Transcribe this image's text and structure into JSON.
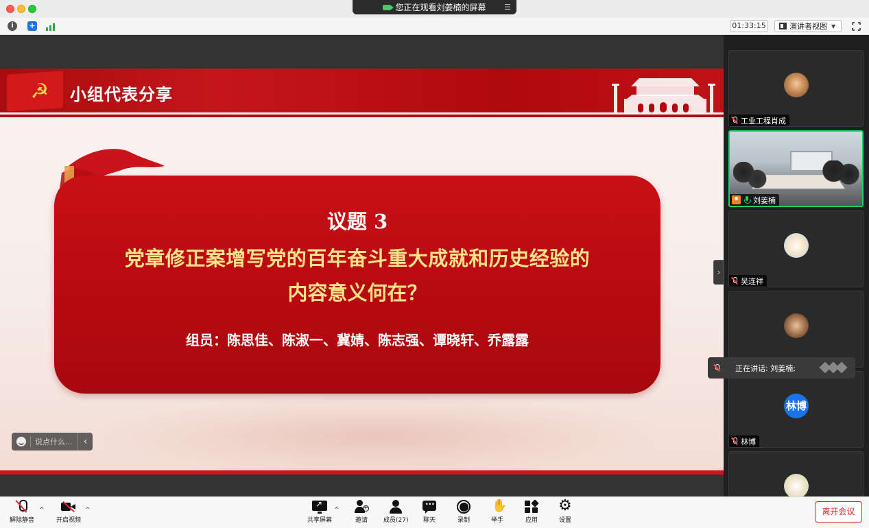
{
  "window": {
    "share_banner": "您正在观看刘姜楠的屏幕"
  },
  "toolbar": {
    "timer": "01:33:15",
    "view_mode": "演讲者视图"
  },
  "slide": {
    "header_title": "小组代表分享",
    "topic": "议题 3",
    "question_line1": "党章修正案增写党的百年奋斗重大成就和历史经验的",
    "question_line2": "内容意义何在？",
    "members": "组员：陈思佳、陈淑一、冀婧、陈志强、谭晓轩、乔露露"
  },
  "chat": {
    "placeholder": "说点什么..."
  },
  "participants": [
    {
      "name": "工业工程肖成",
      "muted": true,
      "avatar": "photo"
    },
    {
      "name": "刘姜楠",
      "muted": false,
      "avatar": "video",
      "active": true
    },
    {
      "name": "吴连祥",
      "muted": true,
      "avatar": "cartoon"
    },
    {
      "name": "",
      "muted": true,
      "avatar": "photo"
    },
    {
      "name": "林博",
      "muted": true,
      "avatar": "initials",
      "initials": "林博"
    },
    {
      "name": "",
      "muted": true,
      "avatar": "cartoon"
    }
  ],
  "speaking": {
    "label": "正在讲话: 刘姜楠;"
  },
  "bottombar": {
    "unmute": "解除静音",
    "start_video": "开启视频",
    "share_screen": "共享屏幕",
    "invite": "邀请",
    "members": "成员(27)",
    "chat": "聊天",
    "record": "录制",
    "raise_hand": "举手",
    "apps": "应用",
    "settings": "设置",
    "leave": "离开会议"
  },
  "colors": {
    "slide_red": "#c4161a",
    "highlight_text": "#ffe38a",
    "active_border": "#23d160",
    "leave_red": "#e5262a"
  }
}
